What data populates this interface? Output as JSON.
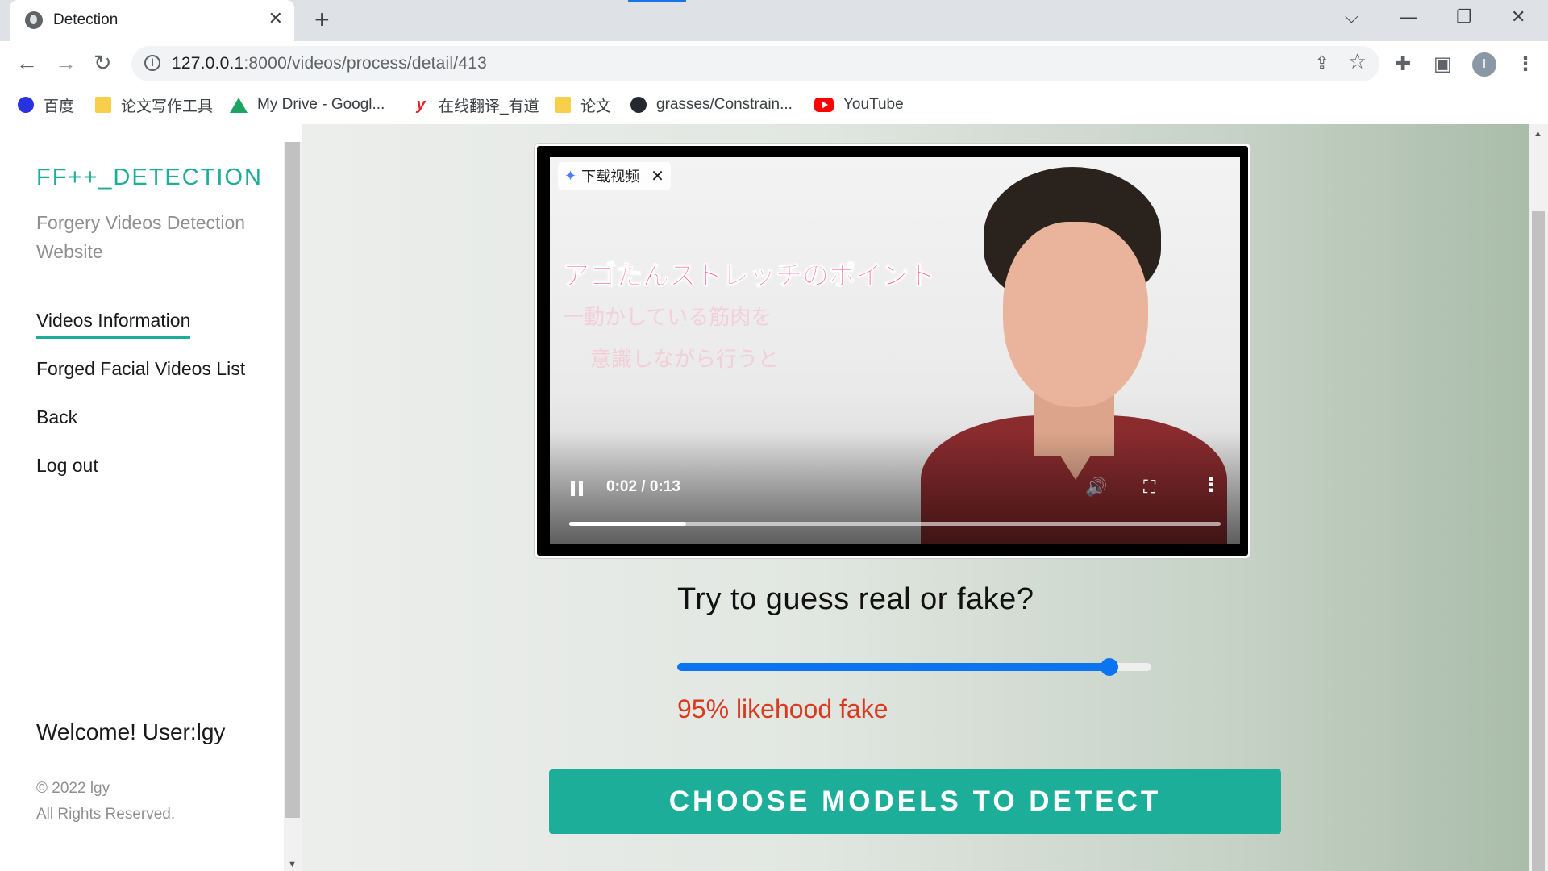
{
  "browser": {
    "tab_title": "Detection",
    "tab_close": "✕",
    "new_tab": "+",
    "url_host": "127.0.0.1",
    "url_rest": ":8000/videos/process/detail/413",
    "window_controls": {
      "dropdown": "⌵",
      "minimize": "—",
      "restore": "❐",
      "close": "✕"
    },
    "nav": {
      "back": "←",
      "forward": "→",
      "reload": "↻"
    },
    "bookmarks": [
      {
        "label": "百度",
        "icon": "baidu-icon"
      },
      {
        "label": "论文写作工具",
        "icon": "folder-icon"
      },
      {
        "label": "My Drive - Googl...",
        "icon": "google-drive-icon"
      },
      {
        "label": "在线翻译_有道",
        "icon": "youdao-icon"
      },
      {
        "label": "论文",
        "icon": "folder-icon"
      },
      {
        "label": "grasses/Constrain...",
        "icon": "github-icon"
      },
      {
        "label": "YouTube",
        "icon": "youtube-icon"
      }
    ],
    "profile_initial": "I"
  },
  "sidebar": {
    "brand": "FF++_DETECTION",
    "subtitle": "Forgery Videos Detection Website",
    "nav": [
      {
        "label": "Videos Information",
        "active": true
      },
      {
        "label": "Forged Facial Videos List",
        "active": false
      },
      {
        "label": "Back",
        "active": false
      },
      {
        "label": "Log out",
        "active": false
      }
    ],
    "welcome": "Welcome! User:lgy",
    "copyright_line1": "© 2022 lgy",
    "copyright_line2": "All Rights Reserved."
  },
  "video": {
    "download_badge": "下载视频",
    "caption_line1": "アゴたんストレッチのポイント",
    "caption_line2": "一動かしている筋肉を",
    "caption_line3": "意識しながら行うと",
    "time": "0:02 / 0:13",
    "progress": 0.18
  },
  "guess": {
    "question": "Try to guess real or fake?",
    "slider_value": 0.95,
    "likelihood_text": "95% likehood fake"
  },
  "detect_button": "CHOOSE MODELS TO DETECT",
  "colors": {
    "accent": "#1dae9a",
    "slider": "#0b74f0",
    "likelihood": "#d9391e"
  }
}
